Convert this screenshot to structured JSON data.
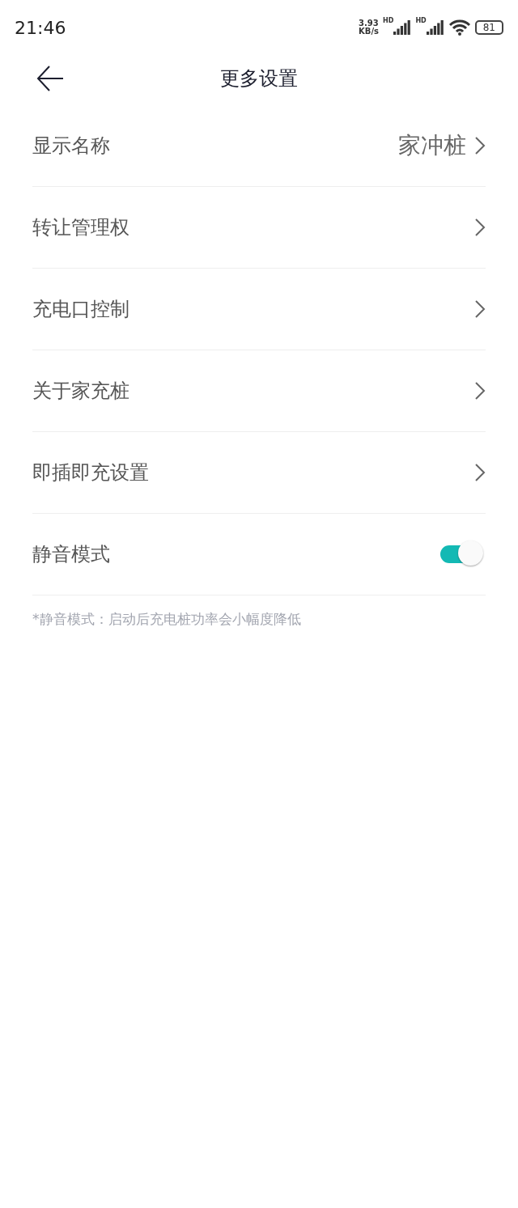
{
  "status_bar": {
    "time": "21:46",
    "speed_value": "3.93",
    "speed_unit": "KB/s",
    "network_labels": [
      "HD",
      "HD"
    ],
    "battery": "81"
  },
  "header": {
    "title": "更多设置"
  },
  "settings": [
    {
      "kind": "link",
      "label": "显示名称",
      "value": "家冲桩"
    },
    {
      "kind": "link",
      "label": "转让管理权"
    },
    {
      "kind": "link",
      "label": "充电口控制"
    },
    {
      "kind": "link",
      "label": "关于家充桩"
    },
    {
      "kind": "link",
      "label": "即插即充设置"
    },
    {
      "kind": "toggle",
      "label": "静音模式",
      "on": true
    }
  ],
  "note": "*静音模式：启动后充电桩功率会小幅度降低"
}
